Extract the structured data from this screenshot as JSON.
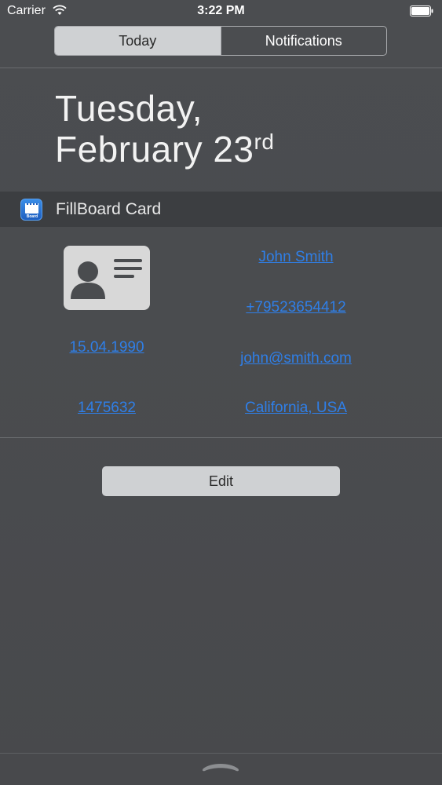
{
  "status_bar": {
    "carrier": "Carrier",
    "time": "3:22 PM",
    "wifi_icon": "wifi-icon",
    "battery_icon": "battery-icon"
  },
  "tabs": [
    {
      "label": "Today",
      "selected": true
    },
    {
      "label": "Notifications",
      "selected": false
    }
  ],
  "date": {
    "line1": "Tuesday,",
    "line2": "February 23",
    "suffix": "rd"
  },
  "widget": {
    "app_icon": "fillboard-app-icon",
    "icon_tag": "Board",
    "title": "FillBoard Card",
    "card_icon": "id-card-icon",
    "fields": {
      "name": "John Smith",
      "phone": "+79523654412",
      "birth_date": "15.04.1990",
      "email": "john@smith.com",
      "id_number": "1475632",
      "location": "California, USA"
    },
    "edit_label": "Edit"
  },
  "colors": {
    "background": "#4a4c4f",
    "link": "#2f7fe8",
    "segment_selected": "#cfd1d3",
    "header_bar": "#3c3e41"
  },
  "bottom": {
    "grabber_icon": "grabber-handle-icon"
  }
}
